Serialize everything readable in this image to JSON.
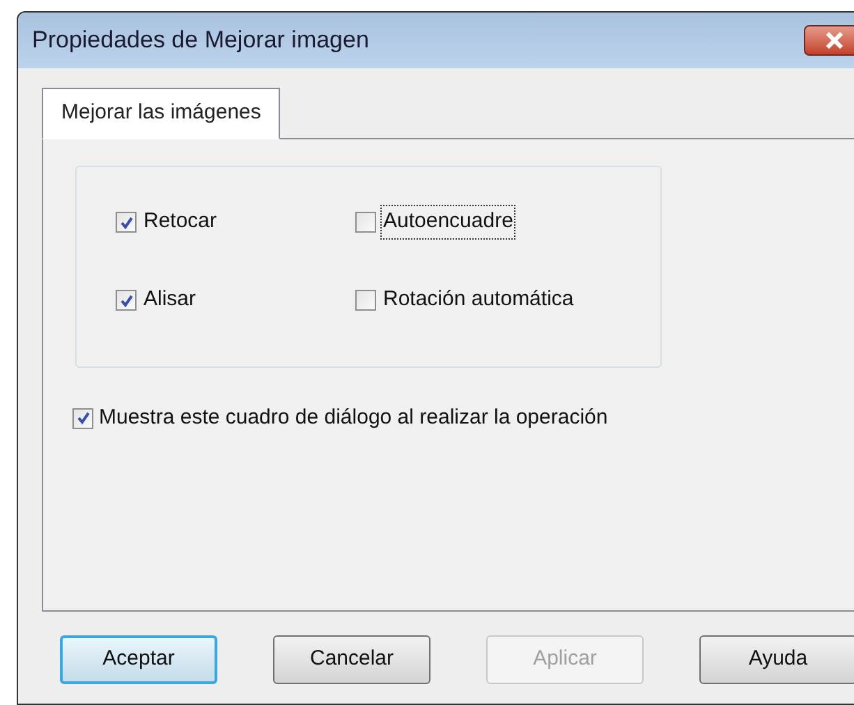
{
  "window": {
    "title": "Propiedades de Mejorar imagen"
  },
  "tabs": [
    {
      "label": "Mejorar las imágenes",
      "selected": true
    }
  ],
  "options": [
    {
      "label": "Retocar",
      "checked": true,
      "focused": false
    },
    {
      "label": "Autoencuadre",
      "checked": false,
      "focused": true
    },
    {
      "label": "Alisar",
      "checked": true,
      "focused": false
    },
    {
      "label": "Rotación automática",
      "checked": false,
      "focused": false
    }
  ],
  "show_dialog": {
    "label": "Muestra este cuadro de diálogo al realizar la operación",
    "checked": true
  },
  "buttons": [
    {
      "label": "Aceptar",
      "default": true,
      "disabled": false
    },
    {
      "label": "Cancelar",
      "default": false,
      "disabled": false
    },
    {
      "label": "Aplicar",
      "default": false,
      "disabled": true
    },
    {
      "label": "Ayuda",
      "default": false,
      "disabled": false
    }
  ]
}
